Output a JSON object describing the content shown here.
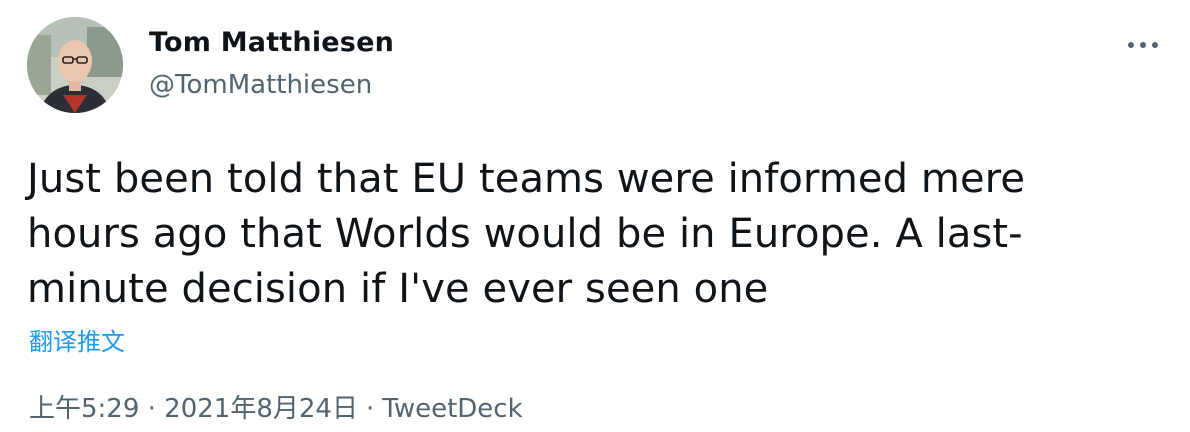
{
  "author": {
    "display_name": "Tom Matthiesen",
    "handle": "@TomMatthiesen",
    "avatar": "avatar"
  },
  "menu": {
    "icon": "more-horizontal-icon"
  },
  "tweet": {
    "text": "Just been told that EU teams were informed mere\nhours ago that Worlds would be in Europe. A last-\nminute decision if I've ever seen one",
    "translate_label": "翻译推文"
  },
  "meta": {
    "timestamp": "上午5:29 · 2021年8月24日",
    "separator": "·",
    "source": "TweetDeck"
  },
  "colors": {
    "link": "#1d9bf0",
    "secondary_text": "#536471",
    "primary_text": "#0f1419"
  }
}
